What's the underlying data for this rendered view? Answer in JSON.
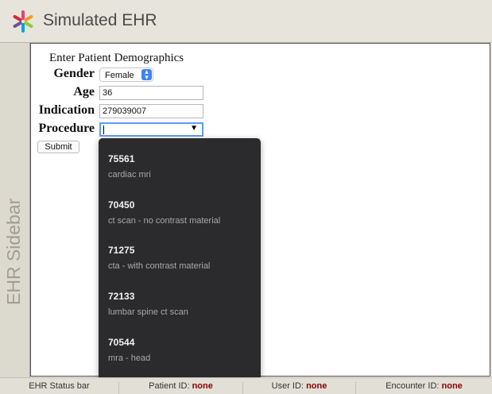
{
  "app": {
    "title": "Simulated EHR"
  },
  "sidebar": {
    "label": "EHR Sidebar"
  },
  "form": {
    "heading": "Enter Patient Demographics",
    "gender": {
      "label": "Gender",
      "value": "Female"
    },
    "age": {
      "label": "Age",
      "value": "36"
    },
    "indication": {
      "label": "Indication",
      "value": "279039007"
    },
    "procedure": {
      "label": "Procedure",
      "value": ""
    },
    "submit_label": "Submit"
  },
  "procedure_options": [
    {
      "code": "75561",
      "description": "cardiac mri"
    },
    {
      "code": "70450",
      "description": "ct scan - no contrast material"
    },
    {
      "code": "71275",
      "description": "cta - with contrast material"
    },
    {
      "code": "72133",
      "description": "lumbar spine ct scan"
    },
    {
      "code": "70544",
      "description": "mra - head"
    }
  ],
  "statusbar": {
    "label": "EHR Status bar",
    "patient_id_label": "Patient ID:",
    "patient_id_value": "none",
    "user_id_label": "User ID:",
    "user_id_value": "none",
    "encounter_id_label": "Encounter ID:",
    "encounter_id_value": "none"
  },
  "colors": {
    "focus_blue": "#5d9cf5",
    "dropdown_bg": "#2b2b2d",
    "status_value": "#8b0000"
  }
}
